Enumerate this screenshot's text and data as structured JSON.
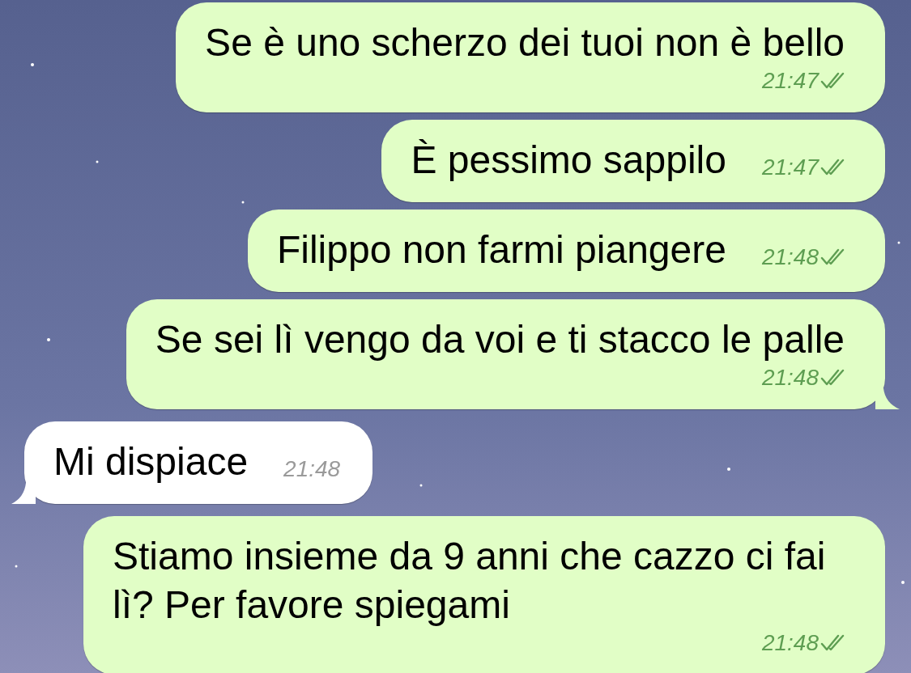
{
  "messages": [
    {
      "kind": "outgoing",
      "text": "Se è uno scherzo dei tuoi non è bello",
      "time": "21:47",
      "time_below": true,
      "read": true,
      "tail": false
    },
    {
      "kind": "outgoing",
      "text": "È pessimo sappilo",
      "time": "21:47",
      "time_below": false,
      "read": true,
      "tail": false
    },
    {
      "kind": "outgoing",
      "text": "Filippo non farmi piangere",
      "time": "21:48",
      "time_below": false,
      "read": true,
      "tail": false
    },
    {
      "kind": "outgoing",
      "text": "Se sei lì vengo da voi e ti stacco le palle",
      "time": "21:48",
      "time_below": true,
      "read": true,
      "tail": true
    },
    {
      "kind": "incoming",
      "text": "Mi dispiace",
      "time": "21:48",
      "time_below": false,
      "tail": true
    },
    {
      "kind": "outgoing",
      "text": "Stiamo insieme da 9 anni che cazzo ci fai lì? Per favore spiegami",
      "time": "21:48",
      "time_below": true,
      "read": true,
      "tail": false
    }
  ]
}
